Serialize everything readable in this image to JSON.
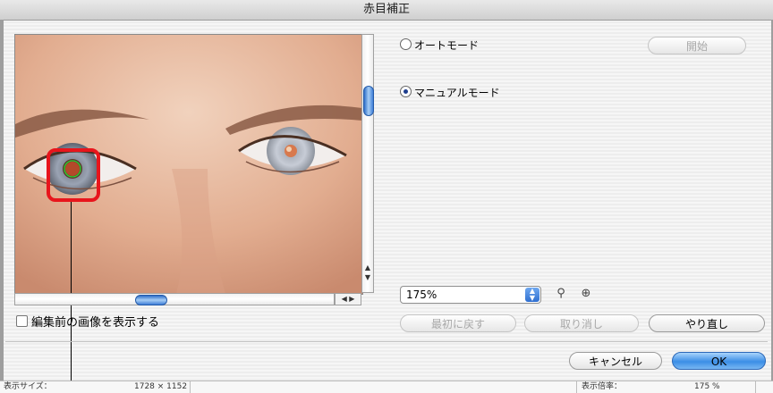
{
  "window": {
    "title": "赤目補正"
  },
  "modes": {
    "auto_label": "オートモード",
    "manual_label": "マニュアルモード",
    "selected": "manual"
  },
  "buttons": {
    "start": "開始",
    "revert_first": "最初に戻す",
    "undo": "取り消し",
    "redo": "やり直し",
    "cancel": "キャンセル",
    "ok": "OK"
  },
  "zoom": {
    "value": "175%",
    "zoom_out_icon": "zoom-out-icon",
    "zoom_in_icon": "zoom-in-icon"
  },
  "show_before": {
    "label": "編集前の画像を表示する",
    "checked": false
  },
  "status": {
    "size_label": "表示サイズ：",
    "size_value": "1728 × 1152",
    "ratio_label": "表示倍率：",
    "ratio_value": "175 %"
  },
  "colors": {
    "highlight": "#e8151c",
    "accent": "#3b8ee6"
  }
}
